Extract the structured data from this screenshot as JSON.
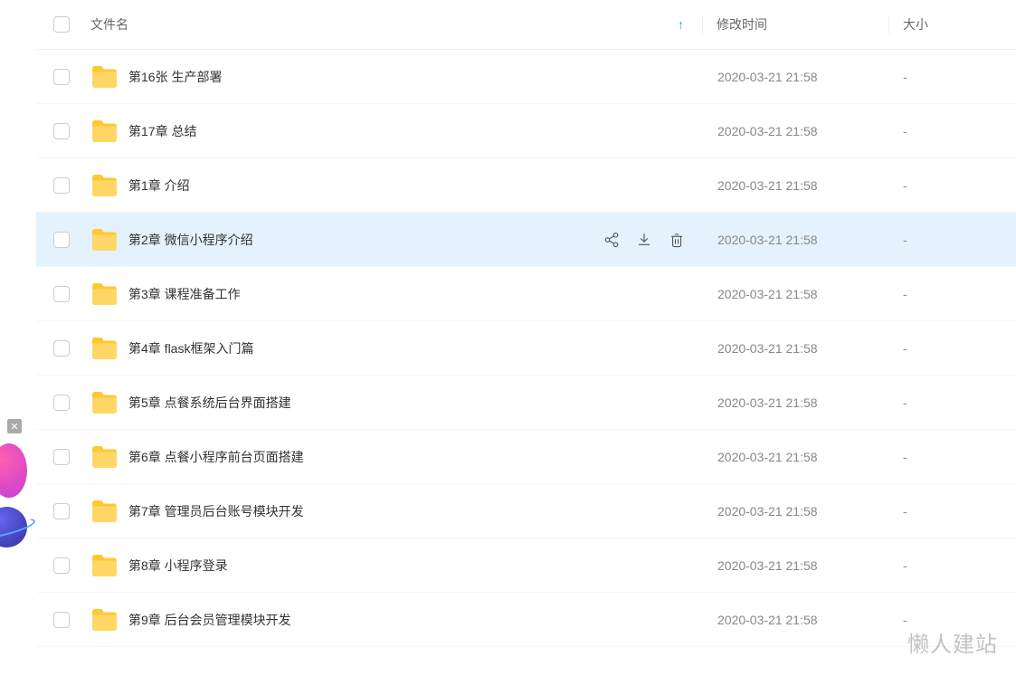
{
  "header": {
    "nameLabel": "文件名",
    "timeLabel": "修改时间",
    "sizeLabel": "大小",
    "sortArrow": "↑"
  },
  "rows": [
    {
      "name": "第16张 生产部署",
      "time": "2020-03-21 21:58",
      "size": "-",
      "hovered": false
    },
    {
      "name": "第17章 总结",
      "time": "2020-03-21 21:58",
      "size": "-",
      "hovered": false
    },
    {
      "name": "第1章 介绍",
      "time": "2020-03-21 21:58",
      "size": "-",
      "hovered": false
    },
    {
      "name": "第2章 微信小程序介绍",
      "time": "2020-03-21 21:58",
      "size": "-",
      "hovered": true
    },
    {
      "name": "第3章 课程准备工作",
      "time": "2020-03-21 21:58",
      "size": "-",
      "hovered": false
    },
    {
      "name": "第4章 flask框架入门篇",
      "time": "2020-03-21 21:58",
      "size": "-",
      "hovered": false
    },
    {
      "name": "第5章 点餐系统后台界面搭建",
      "time": "2020-03-21 21:58",
      "size": "-",
      "hovered": false
    },
    {
      "name": "第6章 点餐小程序前台页面搭建",
      "time": "2020-03-21 21:58",
      "size": "-",
      "hovered": false
    },
    {
      "name": "第7章 管理员后台账号模块开发",
      "time": "2020-03-21 21:58",
      "size": "-",
      "hovered": false
    },
    {
      "name": "第8章 小程序登录",
      "time": "2020-03-21 21:58",
      "size": "-",
      "hovered": false
    },
    {
      "name": "第9章 后台会员管理模块开发",
      "time": "2020-03-21 21:58",
      "size": "-",
      "hovered": false
    }
  ],
  "watermark": "懒人建站"
}
